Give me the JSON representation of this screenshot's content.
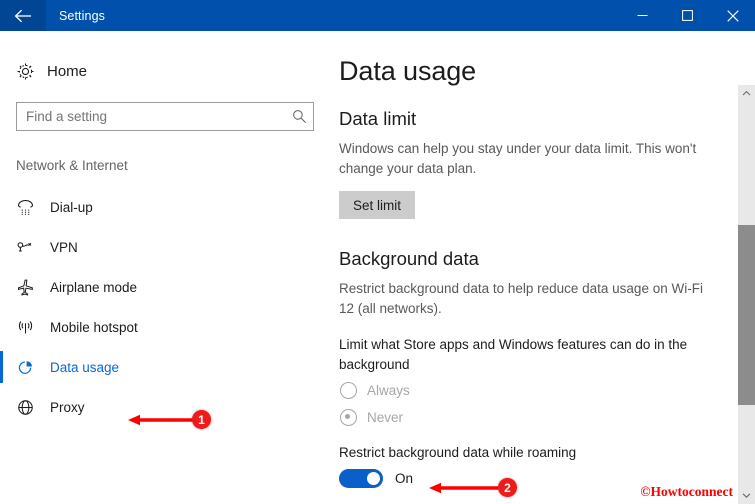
{
  "window": {
    "title": "Settings",
    "back_icon": "back-arrow-icon",
    "minimize_icon": "minimize-icon",
    "maximize_icon": "maximize-icon",
    "close_icon": "close-icon",
    "titlebar_color": "#0050ac",
    "back_button_color": "#004695"
  },
  "sidebar": {
    "home": {
      "label": "Home",
      "icon": "gear-icon"
    },
    "search": {
      "value": "",
      "placeholder": "Find a setting",
      "icon": "search-icon"
    },
    "group_title": "Network & Internet",
    "accent_color": "#0a67d8",
    "items": [
      {
        "label": "Dial-up",
        "icon": "dialup-phone-icon",
        "selected": false
      },
      {
        "label": "VPN",
        "icon": "vpn-key-icon",
        "selected": false
      },
      {
        "label": "Airplane mode",
        "icon": "airplane-icon",
        "selected": false
      },
      {
        "label": "Mobile hotspot",
        "icon": "hotspot-signal-icon",
        "selected": false
      },
      {
        "label": "Data usage",
        "icon": "pie-chart-icon",
        "selected": true
      },
      {
        "label": "Proxy",
        "icon": "globe-icon",
        "selected": false
      }
    ]
  },
  "main": {
    "page_title": "Data usage",
    "data_limit": {
      "heading": "Data limit",
      "description": "Windows can help you stay under your data limit. This won't change your data plan.",
      "button_label": "Set limit"
    },
    "background_data": {
      "heading": "Background data",
      "description": "Restrict background data to help reduce data usage on Wi-Fi 12 (all networks).",
      "limit_label": "Limit what Store apps and Windows features can do in the background",
      "radios": [
        {
          "label": "Always",
          "checked": false,
          "disabled": true
        },
        {
          "label": "Never",
          "checked": true,
          "disabled": true
        }
      ],
      "roaming_label": "Restrict background data while roaming",
      "toggle": {
        "state_label": "On",
        "on": true,
        "color": "#0a5fc8"
      }
    }
  },
  "scrollbar": {
    "up_icon": "chevron-up-icon",
    "down_icon": "chevron-down-icon",
    "thumb_color": "#8c8c8c",
    "track_color": "#e8e8e8"
  },
  "annotations": {
    "color": "#ff0000",
    "markers": [
      {
        "number": "1",
        "target": "sidebar-item-data-usage"
      },
      {
        "number": "2",
        "target": "roaming-toggle"
      }
    ],
    "watermark": "©Howtoconnect"
  }
}
